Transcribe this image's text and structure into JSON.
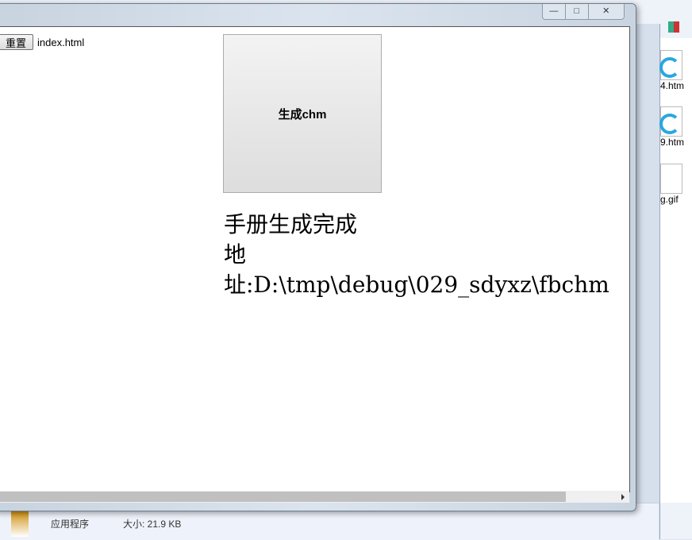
{
  "explorer": {
    "files": [
      {
        "label": "4.htm"
      },
      {
        "label": "9.htm"
      },
      {
        "label": "g.gif"
      }
    ],
    "details": {
      "type": "应用程序",
      "size": "大小: 21.9 KB"
    }
  },
  "window": {
    "controls": {
      "minimize": "—",
      "maximize": "□",
      "close": "✕"
    }
  },
  "page": {
    "reset_label": "重置",
    "file_name": "index.html",
    "generate_label": "生成chm",
    "result_line1": "手册生成完成",
    "result_line2": "地址:D:\\tmp\\debug\\029_sdyxz\\fbchm"
  }
}
